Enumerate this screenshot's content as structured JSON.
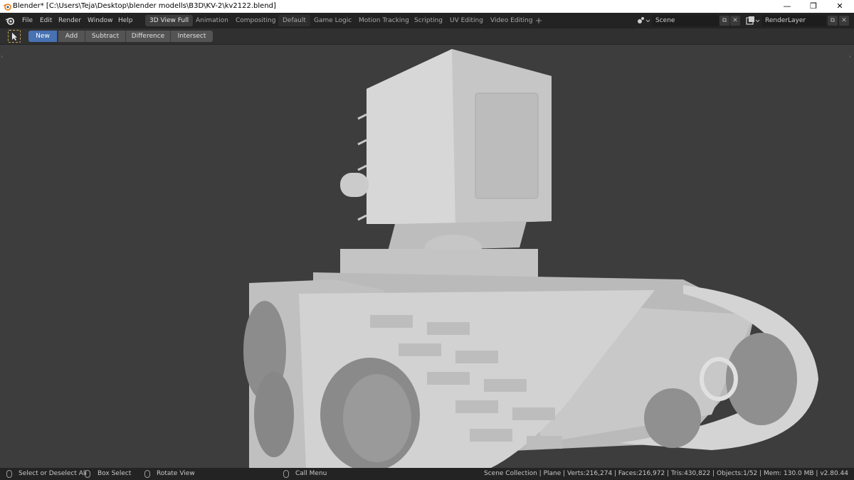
{
  "window": {
    "title": "Blender* [C:\\Users\\Teja\\Desktop\\blender modells\\B3D\\KV-2\\kv2122.blend]",
    "minimize": "—",
    "maximize": "❐",
    "close": "✕"
  },
  "menu": {
    "items": [
      "File",
      "Edit",
      "Render",
      "Window",
      "Help"
    ]
  },
  "workspaces": {
    "tabs": [
      "3D View Full",
      "Animation",
      "Compositing",
      "Default",
      "Game Logic",
      "Motion Tracking",
      "Scripting",
      "UV Editing",
      "Video Editing"
    ],
    "active": "3D View Full",
    "add": "+"
  },
  "scene": {
    "label": "Scene"
  },
  "render_layer": {
    "label": "RenderLayer"
  },
  "toolbar": {
    "operations": [
      "New",
      "Add",
      "Subtract",
      "Difference",
      "Intersect"
    ],
    "active": "New"
  },
  "status": {
    "select_all": "Select or Deselect All",
    "box_select": "Box Select",
    "rotate_view": "Rotate View",
    "call_menu": "Call Menu",
    "stats": "Scene Collection | Plane | Verts:216,274 | Faces:216,972 | Tris:430,822 | Objects:1/52 | Mem: 130.0 MB | v2.80.44"
  },
  "colors": {
    "accent": "#4772b3",
    "background": "#3d3d3d",
    "header": "#232323"
  }
}
